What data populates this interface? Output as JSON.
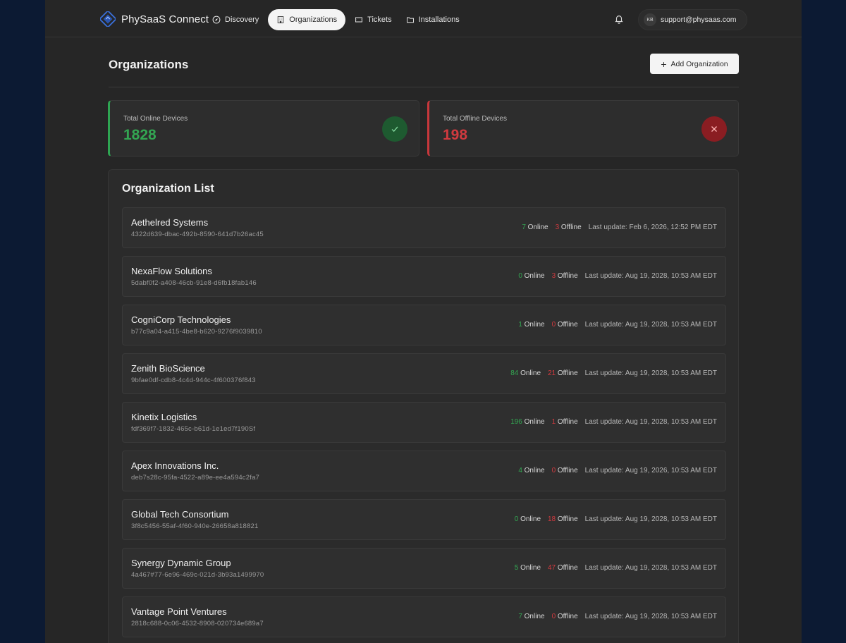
{
  "app": {
    "name": "PhySaaS Connect"
  },
  "nav": [
    {
      "label": "Discovery",
      "icon": "compass-icon",
      "active": false
    },
    {
      "label": "Organizations",
      "icon": "building-icon",
      "active": true
    },
    {
      "label": "Tickets",
      "icon": "ticket-icon",
      "active": false
    },
    {
      "label": "Installations",
      "icon": "folder-icon",
      "active": false
    }
  ],
  "user": {
    "initials": "KB",
    "email": "support@physaas.com"
  },
  "page": {
    "title": "Organizations",
    "add_button": "Add Organization"
  },
  "stats": {
    "online": {
      "label": "Total Online Devices",
      "value": "1828",
      "color": "#33a652"
    },
    "offline": {
      "label": "Total Offline Devices",
      "value": "198",
      "color": "#d13a3f"
    }
  },
  "list": {
    "title": "Organization List",
    "online_word": "Online",
    "offline_word": "Offline",
    "items": [
      {
        "name": "Aethelred Systems",
        "id": "4322d639-dbac-492b-8590-641d7b26ac45",
        "online": "7",
        "offline": "3",
        "updated": "Last update: Feb 6, 2026, 12:52 PM EDT"
      },
      {
        "name": "NexaFlow Solutions",
        "id": "5dabf0f2-a408-46cb-91e8-d6fb18fab146",
        "online": "0",
        "offline": "3",
        "updated": "Last update: Aug 19, 2028, 10:53 AM EDT"
      },
      {
        "name": "CogniCorp Technologies",
        "id": "b77c9a04-a415-4be8-b620-9276f9039810",
        "online": "1",
        "offline": "0",
        "updated": "Last update: Aug 19, 2028, 10:53 AM EDT"
      },
      {
        "name": "Zenith BioScience",
        "id": "9bfae0df-cdb8-4c4d-944c-4f600376f843",
        "online": "84",
        "offline": "21",
        "updated": "Last update: Aug 19, 2028, 10:53 AM EDT"
      },
      {
        "name": "Kinetix Logistics",
        "id": "fdf369f7-1832-465c-b61d-1e1ed7f190Sf",
        "online": "196",
        "offline": "1",
        "updated": "Last update: Aug 19, 2028, 10:53 AM EDT"
      },
      {
        "name": "Apex Innovations Inc.",
        "id": "deb7s28c-95fa-4522-a89e-ee4a594c2fa7",
        "online": "4",
        "offline": "0",
        "updated": "Last update: Aug 19, 2026, 10:53 AM EDT"
      },
      {
        "name": "Global Tech Consortium",
        "id": "3f8c5456-55af-4f60-940e-26658a818821",
        "online": "0",
        "offline": "18",
        "updated": "Last update: Aug 19, 2028, 10:53 AM EDT"
      },
      {
        "name": "Synergy Dynamic Group",
        "id": "4a467#77-6e96-469c-021d-3b93a1499970",
        "online": "5",
        "offline": "47",
        "updated": "Last update: Aug 19, 2028, 10:53 AM EDT"
      },
      {
        "name": "Vantage Point Ventures",
        "id": "2818c688-0c06-4532-8908-020734e689a7",
        "online": "7",
        "offline": "0",
        "updated": "Last update: Aug 19, 2028, 10:53 AM EDT"
      }
    ]
  }
}
